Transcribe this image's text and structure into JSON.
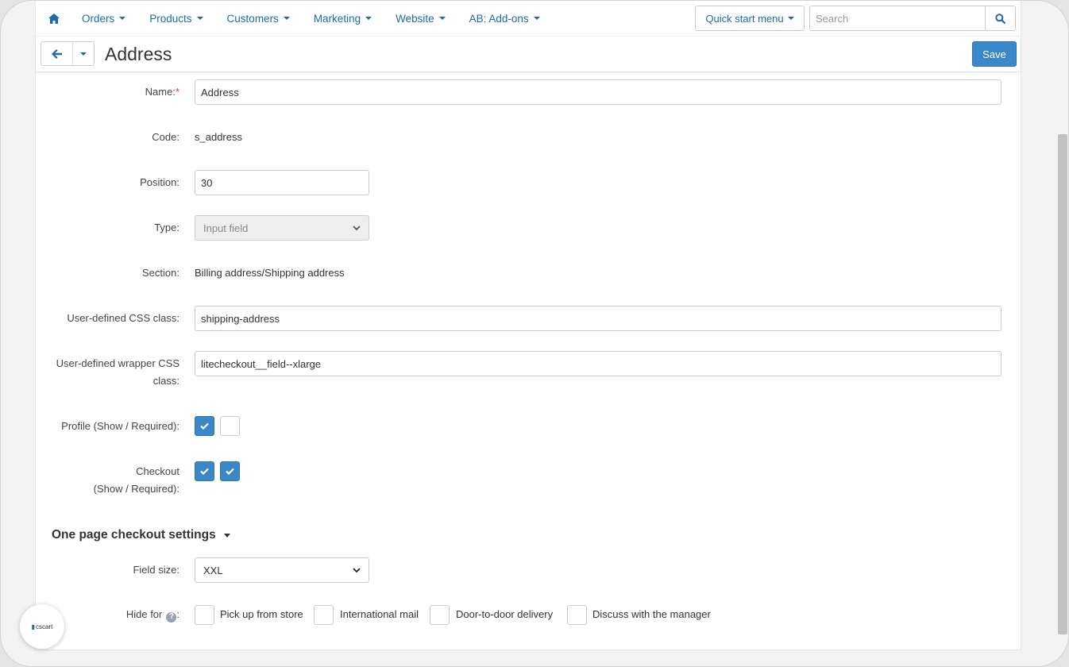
{
  "nav": {
    "items": [
      {
        "label": "Orders"
      },
      {
        "label": "Products"
      },
      {
        "label": "Customers"
      },
      {
        "label": "Marketing"
      },
      {
        "label": "Website"
      },
      {
        "label": "AB: Add-ons"
      }
    ],
    "quick_start_label": "Quick start menu",
    "search_placeholder": "Search"
  },
  "header": {
    "title": "Address",
    "save_label": "Save"
  },
  "form": {
    "name": {
      "label": "Name:",
      "required_mark": "*",
      "value": "Address"
    },
    "code": {
      "label": "Code:",
      "value": "s_address"
    },
    "position": {
      "label": "Position:",
      "value": "30"
    },
    "type": {
      "label": "Type:",
      "value": "Input field"
    },
    "section": {
      "label": "Section:",
      "value": "Billing address/Shipping address"
    },
    "css_class": {
      "label": "User-defined CSS class:",
      "value": "shipping-address"
    },
    "wrapper_css": {
      "label_line1": "User-defined wrapper CSS",
      "label_line2": "class:",
      "value": "litecheckout__field--xlarge"
    },
    "profile": {
      "label": "Profile (Show / Required):",
      "show": true,
      "required": false
    },
    "checkout": {
      "label_line1": "Checkout",
      "label_line2": "(Show / Required):",
      "show": true,
      "required": true
    }
  },
  "one_page": {
    "heading": "One page checkout settings",
    "field_size": {
      "label": "Field size:",
      "value": "XXL"
    },
    "hide_for": {
      "label": "Hide for",
      "help": "?",
      "options": [
        {
          "label": "Pick up from store",
          "checked": false
        },
        {
          "label": "International mail",
          "checked": false
        },
        {
          "label": "Door-to-door delivery",
          "checked": false
        },
        {
          "label": "Discuss with the manager",
          "checked": false
        }
      ]
    }
  },
  "logo": {
    "text": "cscart"
  },
  "colors": {
    "accent": "#3a87ca",
    "link": "#1f6aab"
  }
}
